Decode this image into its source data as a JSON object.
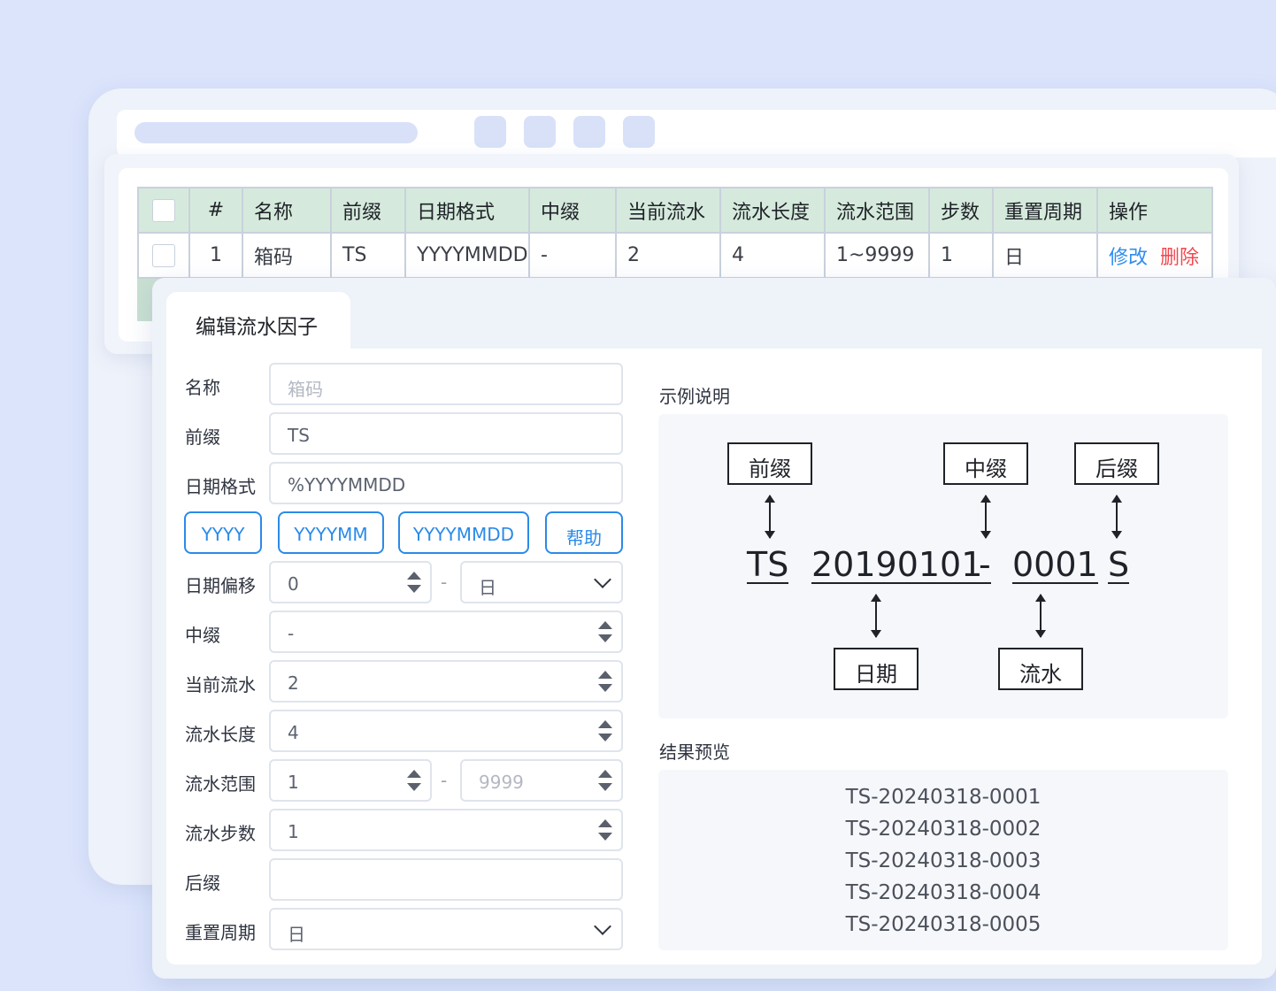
{
  "colors": {
    "accent": "#2b8ae8",
    "danger": "#f2484f",
    "header_bg": "#d5eadc",
    "page_bg": "#dbe4fb"
  },
  "table": {
    "headers": [
      "#",
      "名称",
      "前缀",
      "日期格式",
      "中缀",
      "当前流水",
      "流水长度",
      "流水范围",
      "步数",
      "重置周期",
      "操作"
    ],
    "rows": [
      {
        "index": "1",
        "name": "箱码",
        "prefix": "TS",
        "date_format": "YYYYMMDD",
        "infix": "-",
        "current_serial": "2",
        "serial_length": "4",
        "serial_range": "1~9999",
        "step": "1",
        "reset_cycle": "日",
        "edit": "修改",
        "delete": "删除"
      }
    ]
  },
  "dialog": {
    "tab_title": "编辑流水因子",
    "form": {
      "name": {
        "label": "名称",
        "placeholder": "箱码"
      },
      "prefix": {
        "label": "前缀",
        "value": "TS"
      },
      "date_format": {
        "label": "日期格式",
        "value": "%YYYYMMDD"
      },
      "format_buttons": [
        "YYYY",
        "YYYYMM",
        "YYYYMMDD",
        "帮助"
      ],
      "date_offset": {
        "label": "日期偏移",
        "value": "0",
        "separator": "-",
        "unit": "日"
      },
      "infix": {
        "label": "中缀",
        "value": "-"
      },
      "current_serial": {
        "label": "当前流水",
        "value": "2"
      },
      "serial_length": {
        "label": "流水长度",
        "value": "4"
      },
      "serial_range": {
        "label": "流水范围",
        "min": "1",
        "separator": "-",
        "max_placeholder": "9999"
      },
      "serial_step": {
        "label": "流水步数",
        "value": "1"
      },
      "suffix": {
        "label": "后缀",
        "value": ""
      },
      "reset_cycle": {
        "label": "重置周期",
        "value": "日"
      }
    },
    "example": {
      "title": "示例说明",
      "boxes": {
        "prefix": "前缀",
        "infix": "中缀",
        "suffix": "后缀",
        "date": "日期",
        "serial": "流水"
      },
      "parts": {
        "prefix": "TS",
        "date": "20190101",
        "infix": "-",
        "serial": "0001",
        "suffix": "S"
      }
    },
    "preview": {
      "title": "结果预览",
      "lines": [
        "TS-20240318-0001",
        "TS-20240318-0002",
        "TS-20240318-0003",
        "TS-20240318-0004",
        "TS-20240318-0005"
      ]
    }
  }
}
